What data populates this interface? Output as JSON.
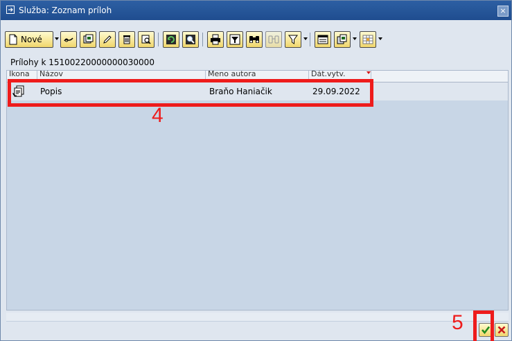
{
  "window": {
    "title": "Služba: Zoznam príloh",
    "close_symbol": "×"
  },
  "toolbar": {
    "new_label": "Nové",
    "icons": [
      "new-document-icon",
      "link-icon",
      "display-icon",
      "edit-pencil-icon",
      "delete-trash-icon",
      "find-icon",
      "refresh-icon",
      "zoom-icon",
      "print-icon",
      "filter-icon",
      "find-binoculars-icon",
      "find-next-icon",
      "filter-funnel-icon",
      "export-icon",
      "copy-icon",
      "layout-grid-icon"
    ]
  },
  "heading": "Prílohy k 15100220000000030000",
  "grid": {
    "columns": [
      "Ikona",
      "Názov",
      "Meno autora",
      "Dát.vytv."
    ],
    "rows": [
      {
        "icon": "attachment-document-icon",
        "name": "Popis",
        "author": "Braňo Haniačik",
        "date": "29.09.2022"
      }
    ]
  },
  "annotations": {
    "step4": "4",
    "step5": "5"
  },
  "actions": {
    "confirm_icon": "checkmark-icon",
    "cancel_icon": "cancel-x-icon"
  },
  "colors": {
    "titlebar": "#1f4d8f",
    "annotation_red": "#ee1c1c",
    "button_yellow": "#f0d66c",
    "grid_bg": "#c8d6e6"
  }
}
